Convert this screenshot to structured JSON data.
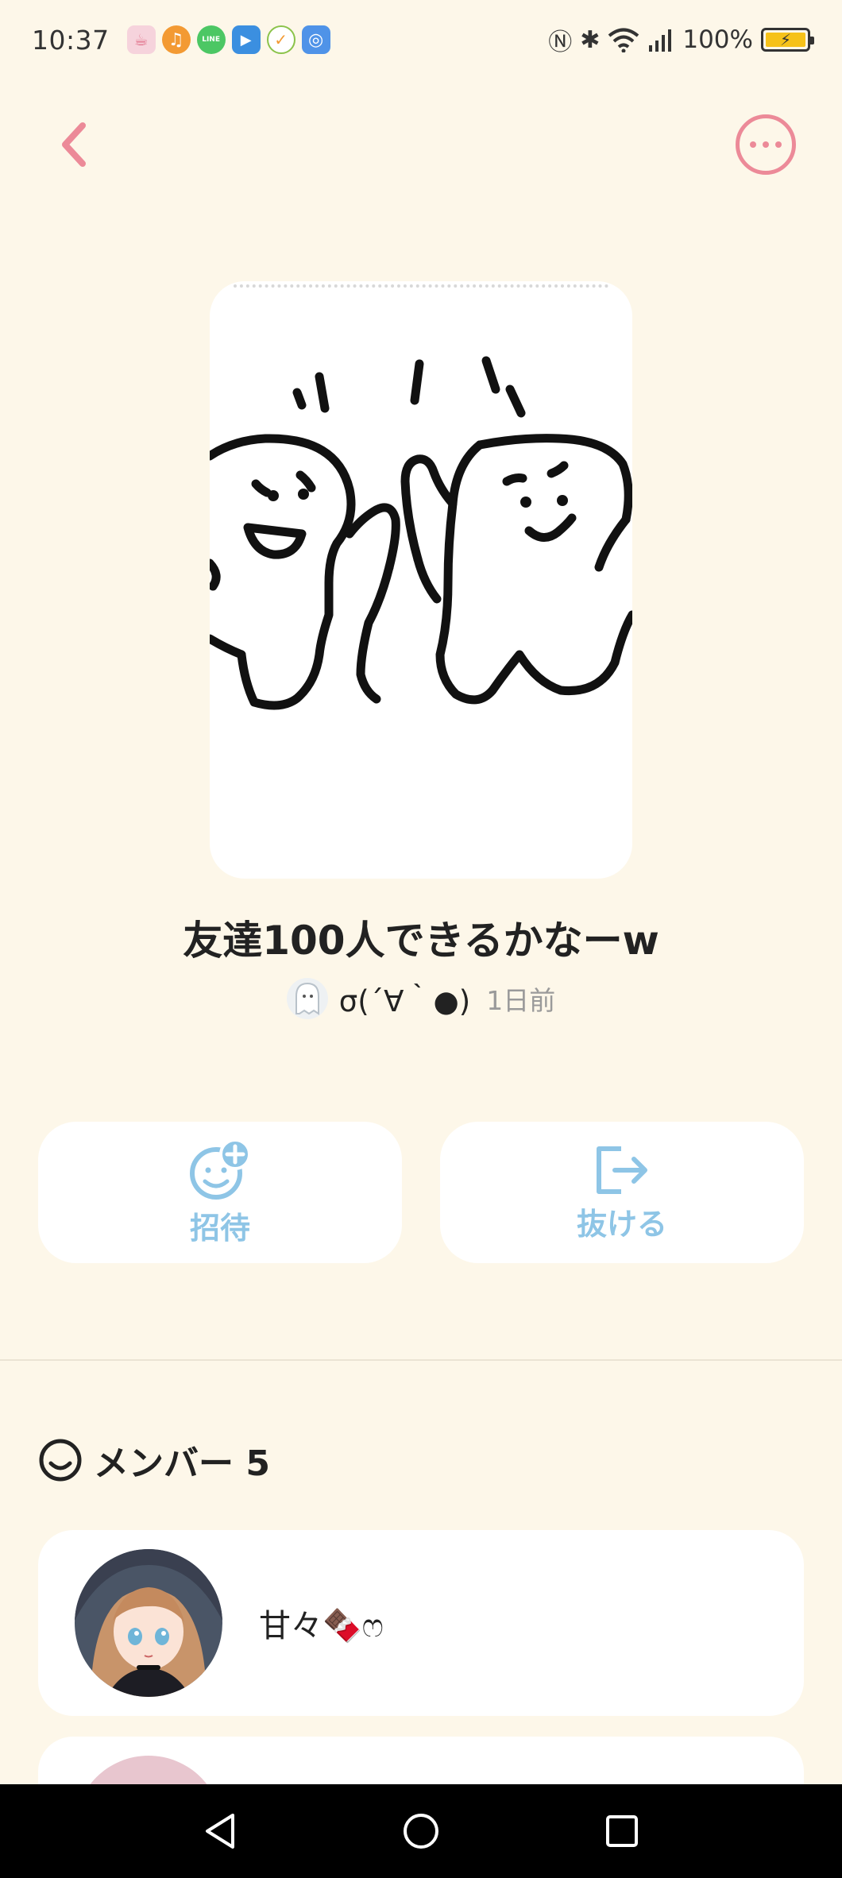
{
  "status_bar": {
    "time": "10:37",
    "battery": "100%",
    "notification_icons": [
      {
        "name": "cup-app-icon",
        "color": "#f2a6b6",
        "glyph": "☕"
      },
      {
        "name": "music-app-icon",
        "color": "#f39a33",
        "glyph": "♫"
      },
      {
        "name": "line-app-icon",
        "color": "#4cc764",
        "glyph": "LINE"
      },
      {
        "name": "video-app-icon",
        "color": "#3b8fe0",
        "glyph": "▶"
      },
      {
        "name": "check-app-icon",
        "color": "#ffffff",
        "glyph": "✓"
      },
      {
        "name": "browser-app-icon",
        "color": "#4f93e8",
        "glyph": "◎"
      }
    ]
  },
  "group": {
    "title": "友達100人できるかなーw",
    "creator_name": "σ(´∀｀●)",
    "created_time": "1日前"
  },
  "actions": {
    "invite_label": "招待",
    "leave_label": "抜ける"
  },
  "members": {
    "header_label": "メンバー 5",
    "list": [
      {
        "name": "甘々🍫ෆ"
      },
      {
        "name": ""
      }
    ]
  },
  "colors": {
    "background": "#fdf7e9",
    "accent_pink": "#ec8a98",
    "accent_blue": "#8ec5e6"
  }
}
